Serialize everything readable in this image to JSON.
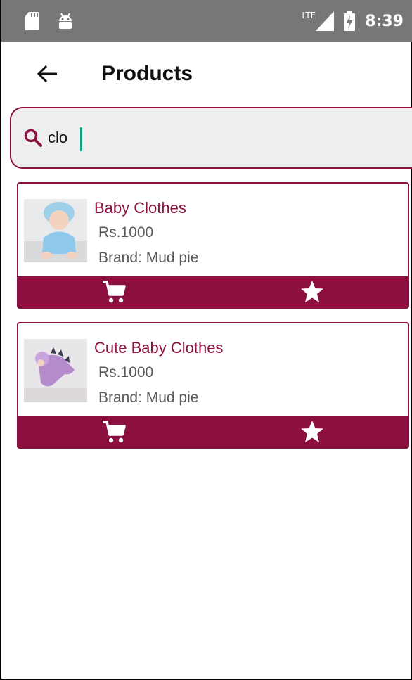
{
  "status_bar": {
    "network": "LTE",
    "time": "8:39",
    "icons": [
      "sd-card-icon",
      "android-icon",
      "signal-icon",
      "battery-charging-icon"
    ]
  },
  "app_bar": {
    "title": "Products",
    "back_icon": "arrow-back-icon"
  },
  "search": {
    "value": "clo",
    "icon": "search-icon"
  },
  "products": [
    {
      "name": "Baby Clothes",
      "price": "Rs.1000",
      "brand": "Brand: Mud pie",
      "image": "baby-blue-outfit"
    },
    {
      "name": "Cute Baby Clothes",
      "price": "Rs.1000",
      "brand": "Brand: Mud pie",
      "image": "baby-purple-dino-outfit"
    }
  ],
  "actions": {
    "cart_icon": "cart-icon",
    "favorite_icon": "star-icon"
  },
  "colors": {
    "accent": "#8b1040",
    "status_bar": "#777777",
    "search_bg": "#eeeeee",
    "caret": "#16a085"
  }
}
